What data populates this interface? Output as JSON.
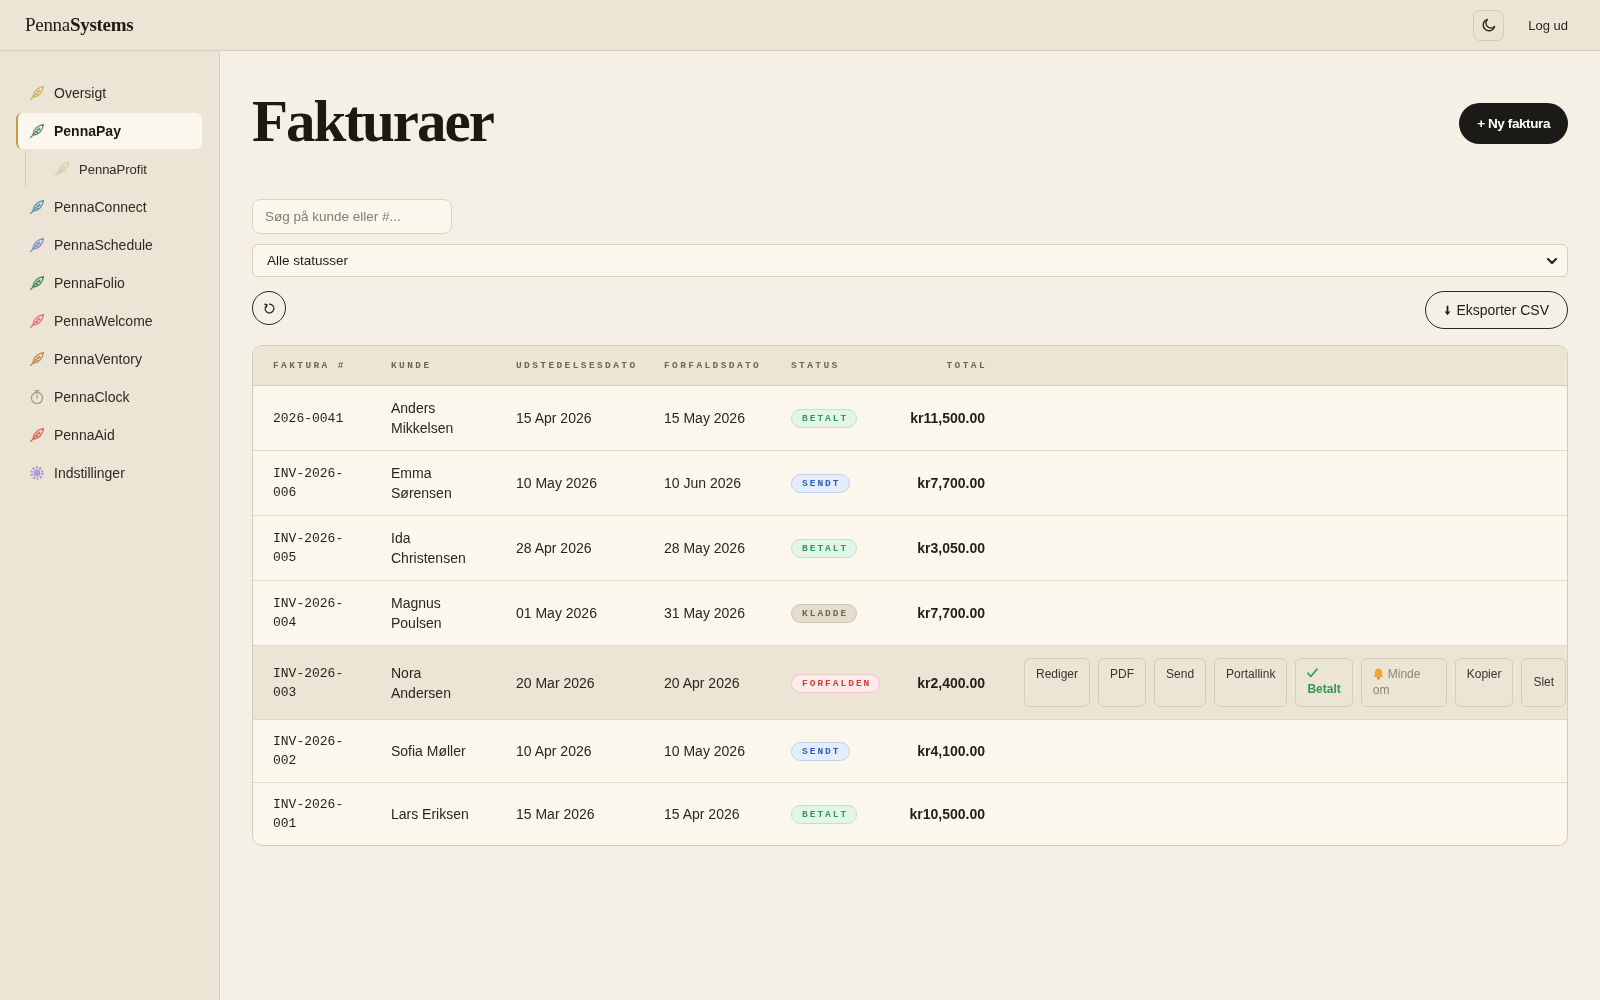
{
  "header": {
    "logo": "Penna**Systems**",
    "logout": "Log ud"
  },
  "sidebar": {
    "items": [
      {
        "label": "Oversigt",
        "kind": "module",
        "color": "#d4b36b",
        "selected": false
      },
      {
        "label": "PennaPay",
        "kind": "module",
        "color": "#5f8b74",
        "selected": true,
        "children": [
          {
            "label": "PennaProfit",
            "kind": "module",
            "color": "#d8ccae",
            "selected": false
          }
        ]
      },
      {
        "label": "PennaConnect",
        "kind": "module",
        "color": "#4b9bab",
        "selected": false
      },
      {
        "label": "PennaSchedule",
        "kind": "module",
        "color": "#7d8cc4",
        "selected": false
      },
      {
        "label": "PennaFolio",
        "kind": "module",
        "color": "#3d8c5c",
        "selected": false
      },
      {
        "label": "PennaWelcome",
        "kind": "module",
        "color": "#de7480",
        "selected": false
      },
      {
        "label": "PennaVentory",
        "kind": "module",
        "color": "#bb8c5e",
        "selected": false
      },
      {
        "label": "PennaClock",
        "kind": "clock",
        "color": "#a39a8c",
        "selected": false
      },
      {
        "label": "PennaAid",
        "kind": "module",
        "color": "#e0664f",
        "selected": false
      },
      {
        "label": "Indstillinger",
        "kind": "settings",
        "color": "#ab9bd6",
        "selected": false
      }
    ]
  },
  "page": {
    "title": "Fakturaer",
    "new_button": "+ Ny faktura"
  },
  "filters": {
    "search": {
      "placeholder": "Søg på kunde eller #..."
    },
    "status_select": {
      "value": "Alle statusser"
    },
    "export_button": "Eksporter CSV"
  },
  "table": {
    "columns": [
      "FAKTURA #",
      "KUNDE",
      "UDSTEDELSESDATO",
      "FORFALDSDATO",
      "STATUS",
      "TOTAL"
    ],
    "rows": [
      {
        "number": "2026-0041",
        "customer": "Anders Mikkelsen",
        "issued": "15 Apr 2026",
        "due": "15 May 2026",
        "status": {
          "label": "BETALT",
          "kind": "paid"
        },
        "total": "kr11,500.00",
        "selected": false
      },
      {
        "number": "INV-2026-006",
        "customer": "Emma Sørensen",
        "issued": "10 May 2026",
        "due": "10 Jun 2026",
        "status": {
          "label": "SENDT",
          "kind": "sent"
        },
        "total": "kr7,700.00",
        "selected": false
      },
      {
        "number": "INV-2026-005",
        "customer": "Ida Christensen",
        "issued": "28 Apr 2026",
        "due": "28 May 2026",
        "status": {
          "label": "BETALT",
          "kind": "paid"
        },
        "total": "kr3,050.00",
        "selected": false
      },
      {
        "number": "INV-2026-004",
        "customer": "Magnus Poulsen",
        "issued": "01 May 2026",
        "due": "31 May 2026",
        "status": {
          "label": "KLADDE",
          "kind": "draft"
        },
        "total": "kr7,700.00",
        "selected": false
      },
      {
        "number": "INV-2026-003",
        "customer": "Nora Andersen",
        "issued": "20 Mar 2026",
        "due": "20 Apr 2026",
        "status": {
          "label": "FORFALDEN",
          "kind": "overdue"
        },
        "total": "kr2,400.00",
        "selected": true,
        "actions": [
          {
            "label": "Rediger",
            "kind": "plain",
            "disabled": false
          },
          {
            "label": "PDF",
            "kind": "plain",
            "disabled": false
          },
          {
            "label": "Send",
            "kind": "plain",
            "disabled": false
          },
          {
            "label": "Portallink",
            "kind": "plain",
            "disabled": false
          },
          {
            "label": "Betalt",
            "kind": "confirm",
            "disabled": false
          },
          {
            "label": "Minde om",
            "kind": "reminder",
            "disabled": true
          },
          {
            "label": "Kopier",
            "kind": "plain",
            "disabled": false
          },
          {
            "label": "Slet",
            "kind": "delete",
            "disabled": false
          }
        ]
      },
      {
        "number": "INV-2026-002",
        "customer": "Sofia Møller",
        "issued": "10 Apr 2026",
        "due": "10 May 2026",
        "status": {
          "label": "SENDT",
          "kind": "sent"
        },
        "total": "kr4,100.00",
        "selected": false
      },
      {
        "number": "INV-2026-001",
        "customer": "Lars Eriksen",
        "issued": "15 Mar 2026",
        "due": "15 Apr 2026",
        "status": {
          "label": "BETALT",
          "kind": "paid"
        },
        "total": "kr10,500.00",
        "selected": false
      }
    ]
  }
}
